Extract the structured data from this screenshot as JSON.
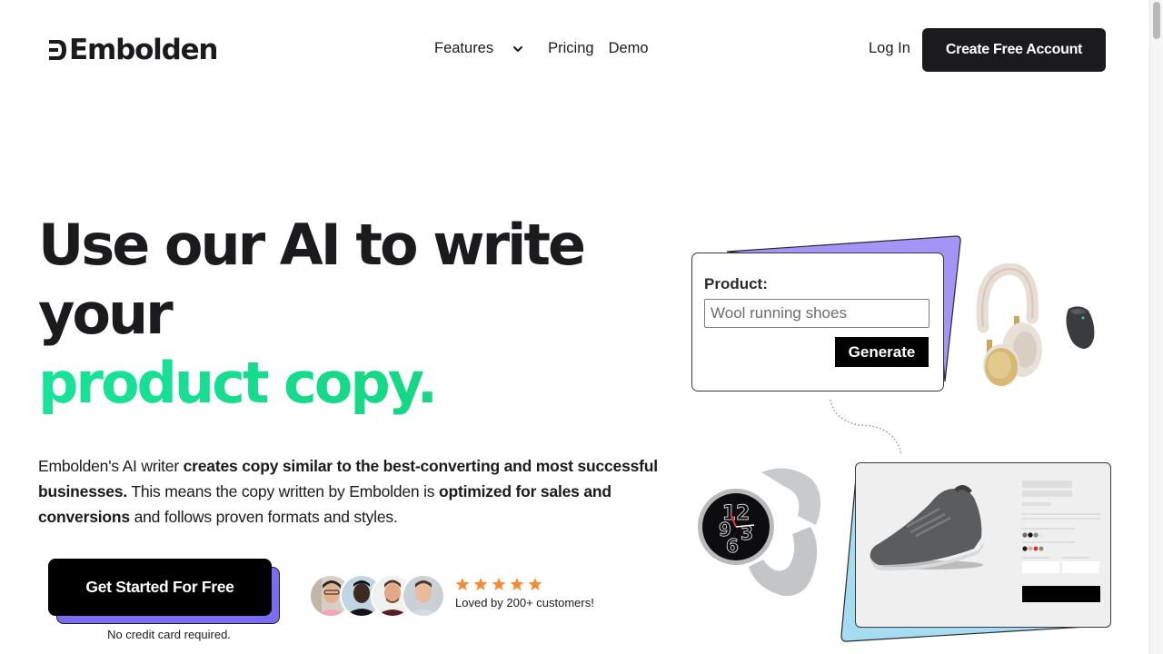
{
  "header": {
    "brand": "Embolden",
    "nav": [
      {
        "label": "Features",
        "has_dropdown": true,
        "icon": "chevron-down-icon"
      },
      {
        "label": "Pricing"
      },
      {
        "label": "Demo"
      }
    ],
    "login_label": "Log In",
    "cta_label": "Create Free Account"
  },
  "hero": {
    "headline_line1": "Use our AI to write",
    "headline_line2": "your",
    "headline_highlight": "product copy.",
    "description": [
      {
        "text": "Embolden's AI writer ",
        "bold": false
      },
      {
        "text": "creates copy similar to the best-converting and most successful businesses.",
        "bold": true
      },
      {
        "text": " This means the copy written by Embolden is ",
        "bold": false
      },
      {
        "text": "optimized for sales and conversions",
        "bold": true
      },
      {
        "text": " and follows proven formats and styles.",
        "bold": false
      }
    ],
    "cta_label": "Get Started For Free",
    "cta_note": "No credit card required.",
    "rating_stars": 5,
    "social_proof": "Loved by 200+ customers!",
    "avatars": [
      "customer-avatar-1",
      "customer-avatar-2",
      "customer-avatar-3",
      "customer-avatar-4"
    ]
  },
  "illustration": {
    "form_label": "Product:",
    "form_input_value": "Wool running shoes",
    "form_button_label": "Generate",
    "products": [
      "headphones",
      "mouse",
      "smartwatch",
      "wool-sneaker"
    ]
  },
  "colors": {
    "brand_dark": "#1b1b1d",
    "accent_green": "#16dc8c",
    "accent_purple": "#7c6cf0",
    "accent_blue": "#a6dcf2",
    "star_orange": "#f58a33"
  }
}
